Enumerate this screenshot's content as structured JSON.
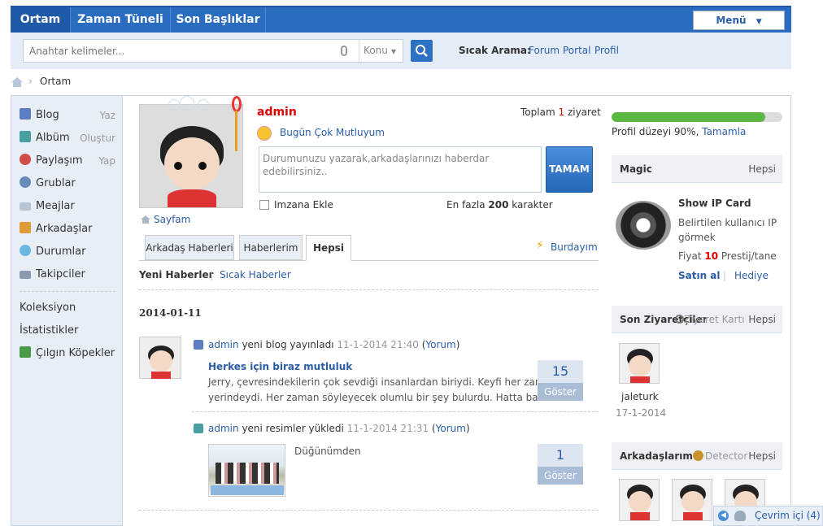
{
  "nav": {
    "tabs": [
      "Ortam",
      "Zaman Tüneli",
      "Son Başlıklar"
    ],
    "menu_label": "Menü"
  },
  "search": {
    "placeholder": "Anahtar kelimeler...",
    "scope": "Konu",
    "hot_label": "Sıcak Arama:",
    "hot_links": [
      "Forum",
      "Portal",
      "Profil"
    ]
  },
  "breadcrumb": {
    "current": "Ortam"
  },
  "sidebar": {
    "items": [
      {
        "label": "Blog",
        "action": "Yaz",
        "color": "#5b7fc4"
      },
      {
        "label": "Albüm",
        "action": "Oluştur",
        "color": "#4aa0a0"
      },
      {
        "label": "Paylaşım",
        "action": "Yap",
        "color": "#d24a4a"
      },
      {
        "label": "Grublar",
        "action": "",
        "color": "#6a8ab8"
      },
      {
        "label": "Meajlar",
        "action": "",
        "color": "#b8c4d4"
      },
      {
        "label": "Arkadaşlar",
        "action": "",
        "color": "#e09a3a"
      },
      {
        "label": "Durumlar",
        "action": "",
        "color": "#6ab8e0"
      },
      {
        "label": "Takipciler",
        "action": "",
        "color": "#8a9ab0"
      }
    ],
    "extra": [
      {
        "label": "Koleksiyon"
      },
      {
        "label": "İstatistikler"
      },
      {
        "label": "Çılgın Köpekler",
        "color": "#4a9a4a"
      }
    ]
  },
  "profile": {
    "username": "admin",
    "mood": "Bugün Çok Mutluyum",
    "visits_prefix": "Toplam",
    "visits": "1",
    "visits_suffix": "ziyaret",
    "status_placeholder": "Durumunuzu yazarak,arkadaşlarınızı haberdar edebilirsiniz..",
    "submit": "TAMAM",
    "signature": "Imzana Ekle",
    "max_prefix": "En fazla",
    "max_chars": "200",
    "max_suffix": "karakter",
    "home_link": "Sayfam"
  },
  "feed_tabs": [
    "Arkadaş Haberleri",
    "Haberlerim",
    "Hepsi"
  ],
  "here_link": "Burdayım",
  "subtabs": [
    "Yeni Haberler",
    "Sıcak Haberler"
  ],
  "feed": {
    "date": "2014-01-11",
    "items": [
      {
        "user": "admin",
        "action": "yeni blog yayınladı",
        "time": "11-1-2014 21:40",
        "comment": "Yorum",
        "title": "Herkes için biraz mutluluk",
        "excerpt1": "Jerry, çevresindekilerin çok sevdiği insanlardan biriydi. Keyfi her zaman",
        "excerpt2": "yerindeydi. Her zaman söyleyecek olumlu bir şey bulurdu. Hatta baz ...",
        "count": "15",
        "count_label": "Göster"
      },
      {
        "user": "admin",
        "action": "yeni resimler yükledi",
        "time": "11-1-2014 21:31",
        "comment": "Yorum",
        "caption": "Düğünümden",
        "count": "1",
        "count_label": "Göster"
      }
    ]
  },
  "right": {
    "progress_text": "Profil düzeyi 90%,",
    "progress_link": "Tamamla",
    "progress_value": 0.9,
    "magic": {
      "title": "Magic",
      "more": "Hepsi",
      "card_title": "Show IP Card",
      "desc1": "Belirtilen kullanıcı IP",
      "desc2": "görmek",
      "price_prefix": "Fiyat",
      "price": "10",
      "price_suffix": "Prestij/tane",
      "buy": "Satın al",
      "gift": "Hediye"
    },
    "visitors": {
      "title": "Son Ziyaretçiler",
      "overlay": "Ziyaret Kartı",
      "more": "Hepsi",
      "name": "jaleturk",
      "date": "17-1-2014"
    },
    "friends": {
      "title": "Arkadaşlarım",
      "detector": "Detector",
      "more": "Hepsi"
    },
    "online": "Çevrim içi (4)"
  }
}
